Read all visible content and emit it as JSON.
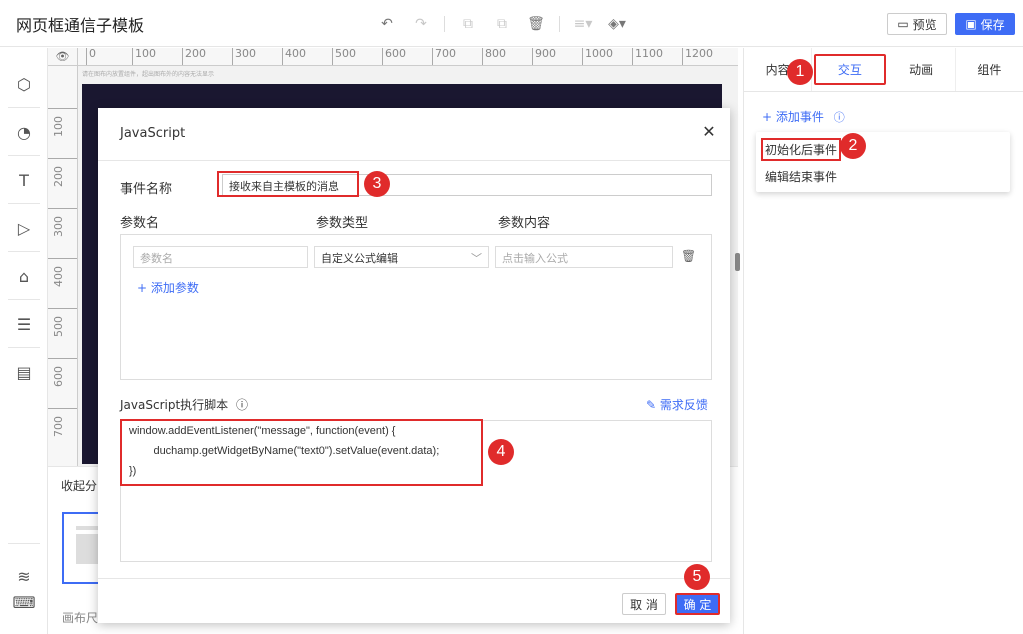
{
  "header": {
    "title": "网页框通信子模板",
    "preview_label": "预览",
    "save_label": "保存"
  },
  "toolbar": {
    "icons": [
      "undo-icon",
      "redo-icon",
      "copy-icon",
      "paste-icon",
      "delete-icon",
      "align-icon",
      "layer-icon"
    ]
  },
  "ruler": {
    "h_ticks": [
      "0",
      "100",
      "200",
      "300",
      "400",
      "500",
      "600",
      "700",
      "800",
      "900",
      "1000",
      "1100",
      "1200"
    ],
    "v_ticks": [
      "100",
      "200",
      "300",
      "400",
      "500",
      "600",
      "700"
    ]
  },
  "canvas": {
    "note": "请在图布内放置组件，超出图布外的内容无法显示"
  },
  "bottom": {
    "collapse_label": "收起分",
    "canvas_size_label": "画布尺"
  },
  "right_panel": {
    "tabs": [
      "内容",
      "交互",
      "动画",
      "组件"
    ],
    "active_tab": "交互",
    "add_event_label": "+ 添加事件",
    "events": [
      "初始化后事件",
      "编辑结束事件"
    ]
  },
  "modal": {
    "title": "JavaScript",
    "event_name_label": "事件名称",
    "event_name_value": "接收来自主模板的消息",
    "param_name_header": "参数名",
    "param_type_header": "参数类型",
    "param_content_header": "参数内容",
    "param_name_placeholder": "参数名",
    "param_type_value": "自定义公式编辑",
    "param_content_placeholder": "点击输入公式",
    "add_param_label": "+ 添加参数",
    "script_label": "JavaScript执行脚本",
    "feedback_label": "需求反馈",
    "code_lines": [
      "window.addEventListener(\"message\", function(event) {",
      "        duchamp.getWidgetByName(\"text0\").setValue(event.data);",
      "})"
    ],
    "cancel_label": "取 消",
    "ok_label": "确 定"
  },
  "markers": [
    "1",
    "2",
    "3",
    "4",
    "5"
  ]
}
